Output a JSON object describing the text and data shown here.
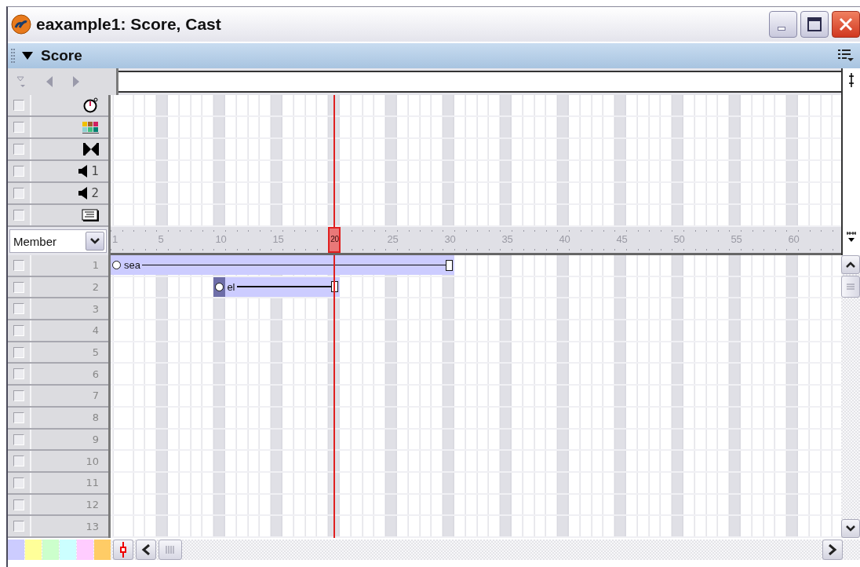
{
  "window": {
    "title": "eaxample1: Score, Cast"
  },
  "panel": {
    "title": "Score"
  },
  "special_channels": [
    {
      "kind": "tempo",
      "checked": false
    },
    {
      "kind": "palette",
      "checked": false
    },
    {
      "kind": "transition",
      "checked": false
    },
    {
      "kind": "sound",
      "label": "1",
      "checked": false
    },
    {
      "kind": "sound",
      "label": "2",
      "checked": false
    },
    {
      "kind": "script",
      "checked": false
    }
  ],
  "ruler": {
    "display": "Member",
    "labels": [
      {
        "text": "1",
        "selected": false
      },
      {
        "text": "5",
        "selected": false
      },
      {
        "text": "10",
        "selected": false
      },
      {
        "text": "15",
        "selected": false
      },
      {
        "text": "20",
        "selected": true
      },
      {
        "text": "25",
        "selected": false
      },
      {
        "text": "30",
        "selected": false
      },
      {
        "text": "35",
        "selected": false
      },
      {
        "text": "40",
        "selected": false
      },
      {
        "text": "45",
        "selected": false
      },
      {
        "text": "50",
        "selected": false
      },
      {
        "text": "55",
        "selected": false
      },
      {
        "text": "60",
        "selected": false
      }
    ]
  },
  "channels": [
    {
      "number": "1",
      "checked": false,
      "sprites": [
        {
          "name": "sea",
          "selected": false
        }
      ]
    },
    {
      "number": "2",
      "checked": false,
      "sprites": [
        {
          "name": "el",
          "selected": true
        }
      ]
    },
    {
      "number": "3",
      "checked": false
    },
    {
      "number": "4",
      "checked": false
    },
    {
      "number": "5",
      "checked": false
    },
    {
      "number": "6",
      "checked": false
    },
    {
      "number": "7",
      "checked": false
    },
    {
      "number": "8",
      "checked": false
    },
    {
      "number": "9",
      "checked": false
    },
    {
      "number": "10",
      "checked": false
    },
    {
      "number": "11",
      "checked": false
    },
    {
      "number": "12",
      "checked": false
    },
    {
      "number": "13",
      "checked": false
    }
  ],
  "color_swatches": [
    {
      "color": "#ccccff"
    },
    {
      "color": "#ffff99"
    },
    {
      "color": "#ccffcc"
    },
    {
      "color": "#ccffff"
    },
    {
      "color": "#ffccff"
    },
    {
      "color": "#ffcc66"
    }
  ]
}
